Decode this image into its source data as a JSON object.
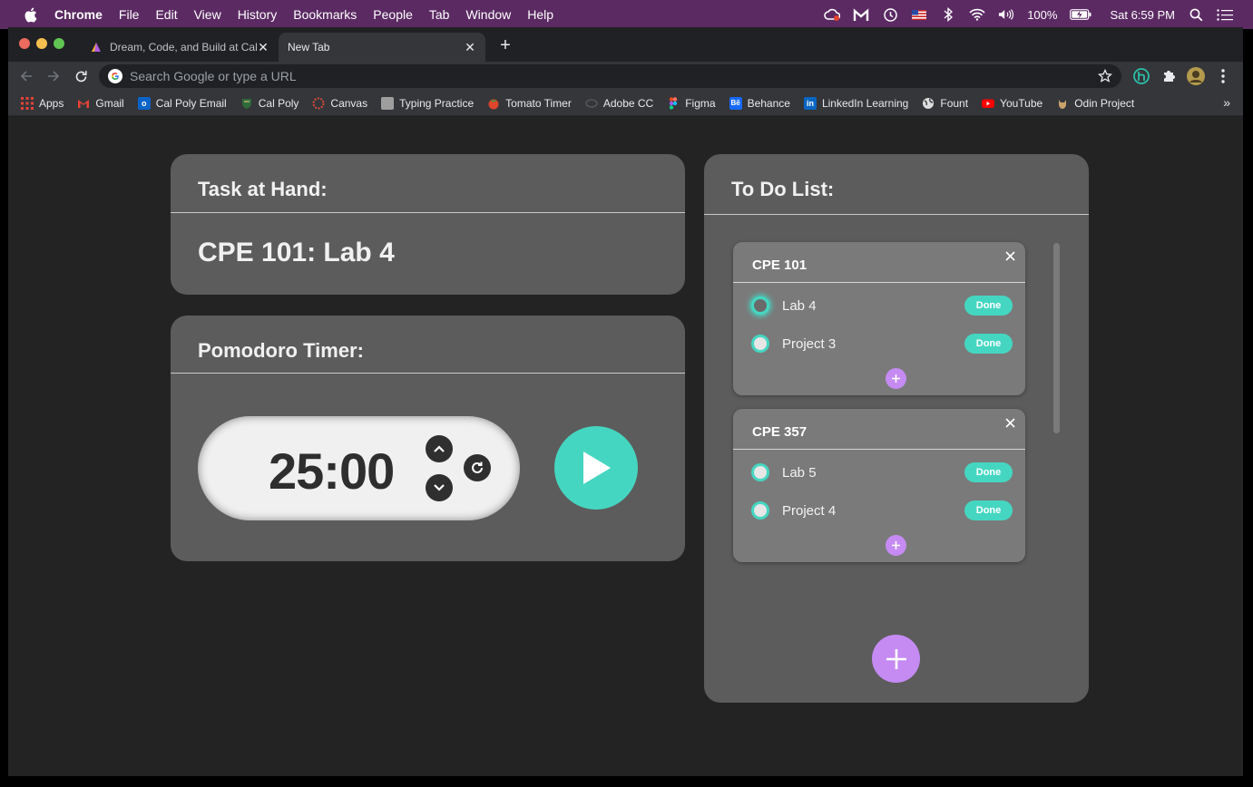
{
  "menubar": {
    "app": "Chrome",
    "items": [
      "File",
      "Edit",
      "View",
      "History",
      "Bookmarks",
      "People",
      "Tab",
      "Window",
      "Help"
    ],
    "battery": "100%",
    "datetime": "Sat 6:59 PM"
  },
  "tabs": [
    {
      "title": "Dream, Code, and Build at Cal",
      "active": false
    },
    {
      "title": "New Tab",
      "active": true
    }
  ],
  "omnibox": {
    "placeholder": "Search Google or type a URL",
    "value": ""
  },
  "bookmarks": [
    {
      "label": "Apps",
      "icon": "apps-grid-icon",
      "color": "#e94235"
    },
    {
      "label": "Gmail",
      "icon": "gmail-icon",
      "color": "#ea4335"
    },
    {
      "label": "Cal Poly Email",
      "icon": "outlook-icon",
      "color": "#0a64c8"
    },
    {
      "label": "Cal Poly",
      "icon": "shield-icon",
      "color": "#2f6b3a"
    },
    {
      "label": "Canvas",
      "icon": "canvas-icon",
      "color": "#d94b3b"
    },
    {
      "label": "Typing Practice",
      "icon": "keyboard-icon",
      "color": "#9e9e9e"
    },
    {
      "label": "Tomato Timer",
      "icon": "tomato-icon",
      "color": "#e0452e"
    },
    {
      "label": "Adobe CC",
      "icon": "adobe-icon",
      "color": "#555555"
    },
    {
      "label": "Figma",
      "icon": "figma-icon",
      "color": "#f24e1e"
    },
    {
      "label": "Behance",
      "icon": "behance-icon",
      "color": "#1769ff"
    },
    {
      "label": "LinkedIn Learning",
      "icon": "linkedin-icon",
      "color": "#0a66c2"
    },
    {
      "label": "Fount",
      "icon": "globe-icon",
      "color": "#dddddd"
    },
    {
      "label": "YouTube",
      "icon": "youtube-icon",
      "color": "#ff0000"
    },
    {
      "label": "Odin Project",
      "icon": "odin-icon",
      "color": "#c9a36a"
    }
  ],
  "bookmarks_more": "»",
  "task": {
    "title": "Task at Hand:",
    "value": "CPE 101: Lab 4"
  },
  "timer": {
    "title": "Pomodoro Timer:",
    "value": "25:00"
  },
  "todo": {
    "title": "To Do List:",
    "groups": [
      {
        "name": "CPE 101",
        "items": [
          {
            "label": "Lab 4",
            "done_label": "Done",
            "focused": true
          },
          {
            "label": "Project 3",
            "done_label": "Done",
            "focused": false
          }
        ]
      },
      {
        "name": "CPE 357",
        "items": [
          {
            "label": "Lab 5",
            "done_label": "Done",
            "focused": false
          },
          {
            "label": "Project 4",
            "done_label": "Done",
            "focused": false
          }
        ]
      }
    ]
  },
  "colors": {
    "accent_teal": "#45d6c1",
    "accent_purple": "#c58bf3",
    "card_bg": "#5c5c5c",
    "page_bg": "#232323",
    "menubar_bg": "#5b2a63"
  }
}
